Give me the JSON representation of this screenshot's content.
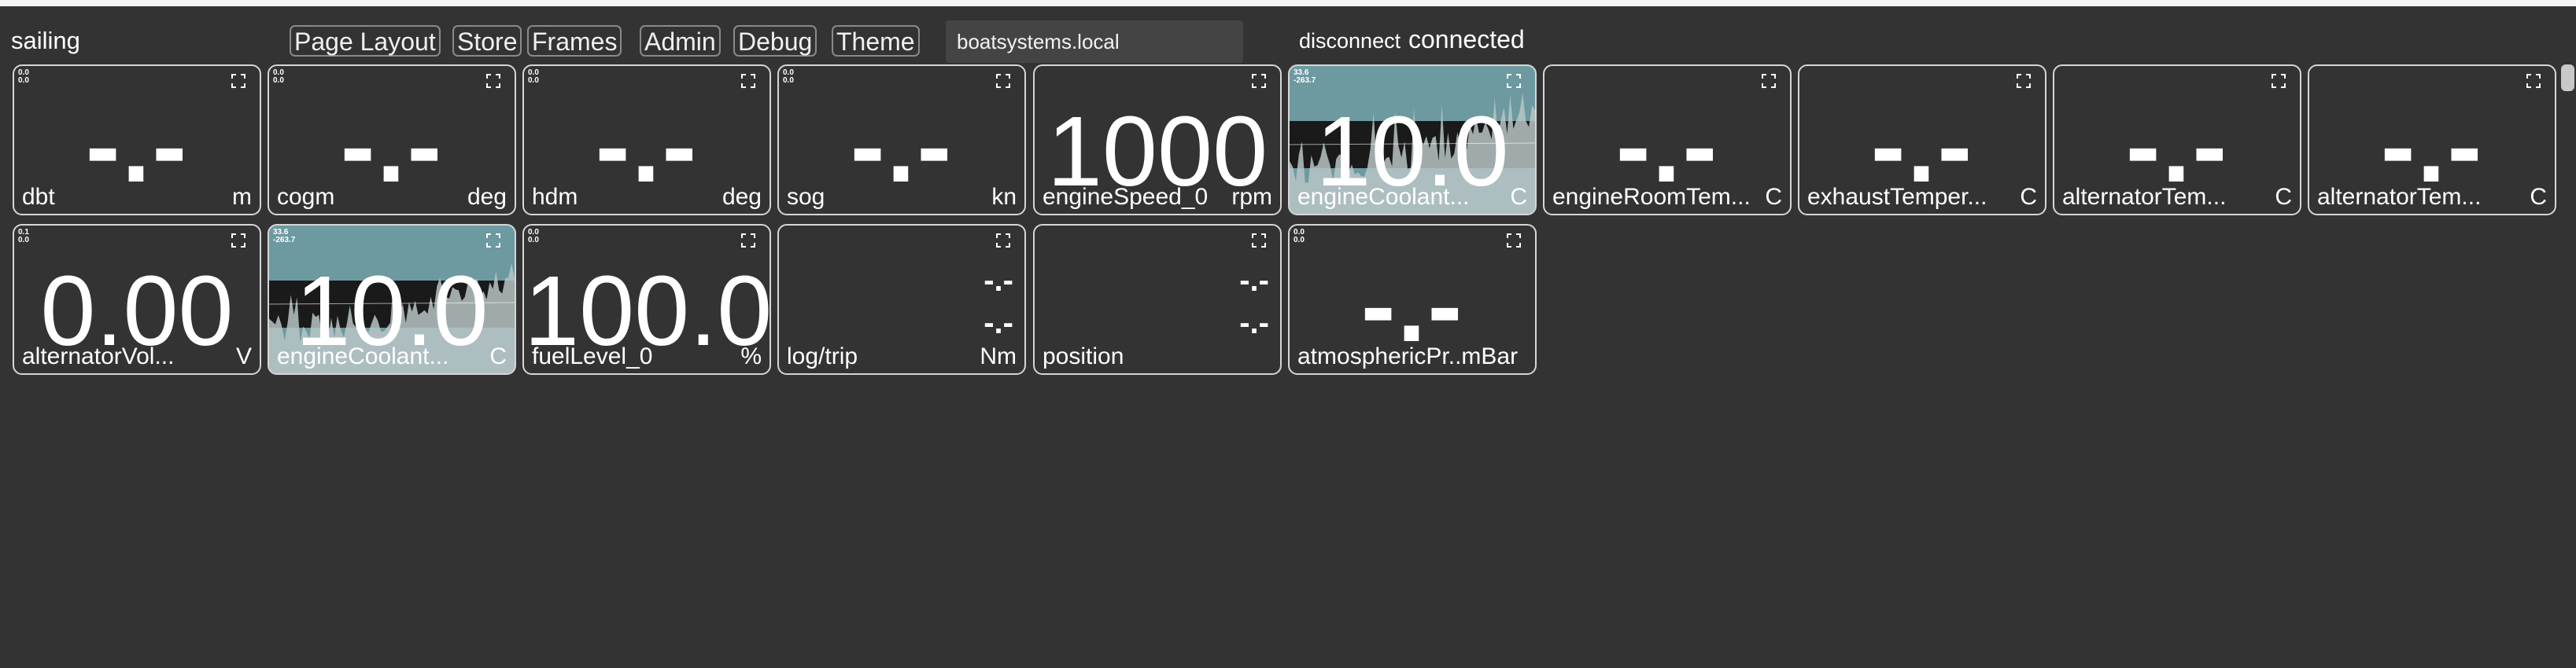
{
  "header": {
    "title": "sailing",
    "nav": [
      "Page Layout",
      "Store",
      "Frames",
      "Admin",
      "Debug",
      "Theme"
    ],
    "host": "boatsystems.local",
    "disconnect_label": "disconnect",
    "status": "connected"
  },
  "colors": {
    "background": "#333333",
    "tile_border": "#d6d6d6",
    "alert_fill": "#6c9aa0",
    "text": "#ffffff"
  },
  "tiles": [
    {
      "name": "dbt",
      "value": "-.-",
      "unit": "m",
      "minmax": "0.0\n0.0"
    },
    {
      "name": "cogm",
      "value": "-.-",
      "unit": "deg",
      "minmax": "0.0\n0.0"
    },
    {
      "name": "hdm",
      "value": "-.-",
      "unit": "deg",
      "minmax": "0.0\n0.0"
    },
    {
      "name": "sog",
      "value": "-.-",
      "unit": "kn",
      "minmax": "0.0\n0.0"
    },
    {
      "name": "engineSpeed_0",
      "value": "1000",
      "unit": "rpm",
      "minmax": ""
    },
    {
      "name": "engineCoolant...",
      "value": "10.0",
      "unit": "C",
      "minmax": "33.6\n-263.7",
      "alert": true,
      "history": true
    },
    {
      "name": "engineRoomTem...",
      "value": "-.-",
      "unit": "C",
      "minmax": ""
    },
    {
      "name": "exhaustTemper...",
      "value": "-.-",
      "unit": "C",
      "minmax": ""
    },
    {
      "name": "alternatorTem...",
      "value": "-.-",
      "unit": "C",
      "minmax": ""
    },
    {
      "name": "alternatorTem...",
      "value": "-.-",
      "unit": "C",
      "minmax": ""
    },
    {
      "name": "alternatorVol...",
      "value": "0.00",
      "unit": "V",
      "minmax": "0.1\n0.0"
    },
    {
      "name": "engineCoolant...",
      "value": "10.0",
      "unit": "C",
      "minmax": "33.6\n-263.7",
      "alert": true,
      "history": true
    },
    {
      "name": "fuelLevel_0",
      "value": "100.0",
      "unit": "%",
      "minmax": "0.0\n0.0"
    },
    {
      "name": "log/trip",
      "value": "-.-",
      "value2": "-.-",
      "unit": "Nm",
      "minmax": "",
      "dual": true
    },
    {
      "name": "position",
      "value": "-.-",
      "value2": "-.-",
      "unit": "",
      "minmax": "",
      "dual": true
    },
    {
      "name": "atmosphericPr..mBar",
      "value": "-.-",
      "unit": "",
      "minmax": "0.0\n0.0"
    }
  ]
}
